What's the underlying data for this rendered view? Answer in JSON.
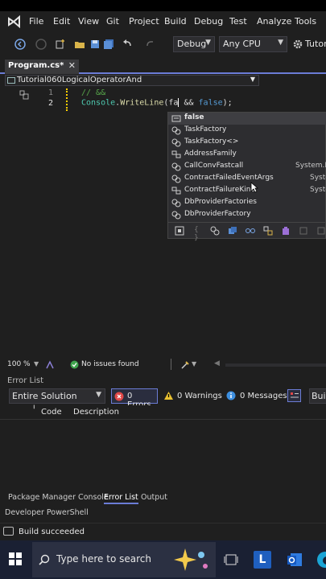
{
  "menu": {
    "items": [
      "File",
      "Edit",
      "View",
      "Git",
      "Project",
      "Build",
      "Debug",
      "Test",
      "Analyze",
      "Tools"
    ]
  },
  "toolbar": {
    "config": "Debug",
    "platform": "Any CPU",
    "run_target": "Tutori"
  },
  "tabs": {
    "active": "Program.cs*"
  },
  "navbar": {
    "project": "Tutorial060LogicalOperatorAnd"
  },
  "editor": {
    "line1_no": "1",
    "line2_no": "2",
    "line1_comment": "// &&",
    "line2_class": "Console",
    "line2_dot": ".",
    "line2_method": "WriteLine",
    "line2_open": "(fa",
    "line2_amp": " && ",
    "line2_false": "false",
    "line2_end": ");"
  },
  "intellisense": {
    "items": [
      {
        "label": "false",
        "ns": ""
      },
      {
        "label": "TaskFactory",
        "ns": ""
      },
      {
        "label": "TaskFactory<>",
        "ns": ""
      },
      {
        "label": "AddressFamily",
        "ns": ""
      },
      {
        "label": "CallConvFastcall",
        "ns": "System.R"
      },
      {
        "label": "ContractFailedEventArgs",
        "ns": "Syste"
      },
      {
        "label": "ContractFailureKind",
        "ns": "Syste"
      },
      {
        "label": "DbProviderFactories",
        "ns": ""
      },
      {
        "label": "DbProviderFactory",
        "ns": ""
      }
    ]
  },
  "editor_status": {
    "zoom": "100 %",
    "issues": "No issues found"
  },
  "error_list": {
    "title": "Error List",
    "scope": "Entire Solution",
    "errors": "0 Errors",
    "warnings": "0 Warnings",
    "messages": "0 Messages",
    "build_label": "Buil",
    "col_code": "Code",
    "col_description": "Description"
  },
  "bottom_tabs": [
    "Package Manager Console",
    "Error List",
    "Output"
  ],
  "dev_powershell": "Developer PowerShell",
  "status": {
    "text": "Build succeeded"
  },
  "taskbar": {
    "search_placeholder": "Type here to search"
  },
  "colors": {
    "accent": "#6b7cd6",
    "keyword": "#569cd6",
    "class": "#4ec9b0",
    "method": "#dcdcaa",
    "comment": "#57a64a",
    "error": "#e04848"
  }
}
